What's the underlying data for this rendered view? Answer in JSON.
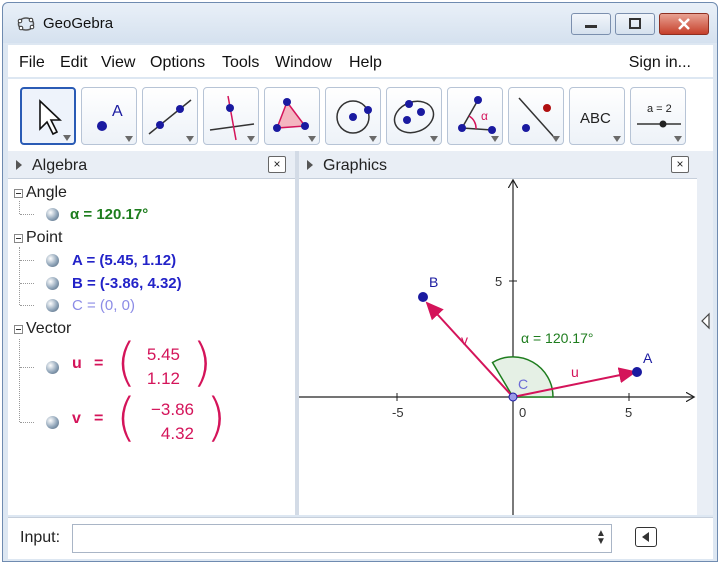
{
  "window": {
    "title": "GeoGebra"
  },
  "menu": {
    "items": [
      "File",
      "Edit",
      "View",
      "Options",
      "Tools",
      "Window",
      "Help"
    ],
    "sign_in": "Sign in..."
  },
  "toolbar": {
    "tools": [
      {
        "name": "move-tool",
        "icon": "arrow-cursor-icon",
        "active": true
      },
      {
        "name": "point-tool",
        "icon": "point-icon",
        "label": "A"
      },
      {
        "name": "line-tool",
        "icon": "line-icon"
      },
      {
        "name": "perpendicular-line-tool",
        "icon": "perpendicular-line-icon"
      },
      {
        "name": "polygon-tool",
        "icon": "polygon-icon"
      },
      {
        "name": "circle-tool",
        "icon": "circle-icon"
      },
      {
        "name": "ellipse-tool",
        "icon": "ellipse-icon"
      },
      {
        "name": "angle-tool",
        "icon": "angle-icon",
        "label": "α"
      },
      {
        "name": "reflect-tool",
        "icon": "reflect-about-line-icon"
      },
      {
        "name": "text-tool",
        "icon": "text-icon",
        "label": "ABC"
      },
      {
        "name": "slider-tool",
        "icon": "slider-icon",
        "label": "a = 2"
      }
    ]
  },
  "algebra": {
    "title": "Algebra",
    "close_label": "×",
    "categories": [
      {
        "label": "Angle",
        "items": [
          {
            "text": "α = 120.17°",
            "color": "#1e7d1e"
          }
        ]
      },
      {
        "label": "Point",
        "items": [
          {
            "text": "A = (5.45, 1.12)",
            "color": "#2323c8"
          },
          {
            "text": "B = (-3.86, 4.32)",
            "color": "#2323c8"
          },
          {
            "text": "C = (0, 0)",
            "color": "#8c8ce6"
          }
        ]
      },
      {
        "label": "Vector",
        "items": [
          {
            "name": "u",
            "eq": "=",
            "x": "5.45",
            "y": "1.12",
            "color": "#d4145a"
          },
          {
            "name": "v",
            "eq": "=",
            "x": "−3.86",
            "y": "4.32",
            "color": "#d4145a"
          }
        ]
      }
    ]
  },
  "graphics": {
    "title": "Graphics",
    "close_label": "×",
    "axis_ticks": {
      "x": [
        "-5",
        "0",
        "5"
      ],
      "y": [
        "5"
      ]
    },
    "points": [
      {
        "label": "A",
        "x": 5.45,
        "y": 1.12
      },
      {
        "label": "B",
        "x": -3.86,
        "y": 4.32
      },
      {
        "label": "C",
        "x": 0,
        "y": 0
      }
    ],
    "vectors": [
      {
        "label": "u",
        "to": "A"
      },
      {
        "label": "v",
        "to": "B"
      }
    ],
    "angle_label": "α = 120.17°",
    "colors": {
      "point": "#1a1aa0",
      "vector": "#d4145a",
      "angle": "#1e7d1e",
      "axis": "#222222"
    }
  },
  "input": {
    "label": "Input:",
    "value": "",
    "placeholder": ""
  }
}
